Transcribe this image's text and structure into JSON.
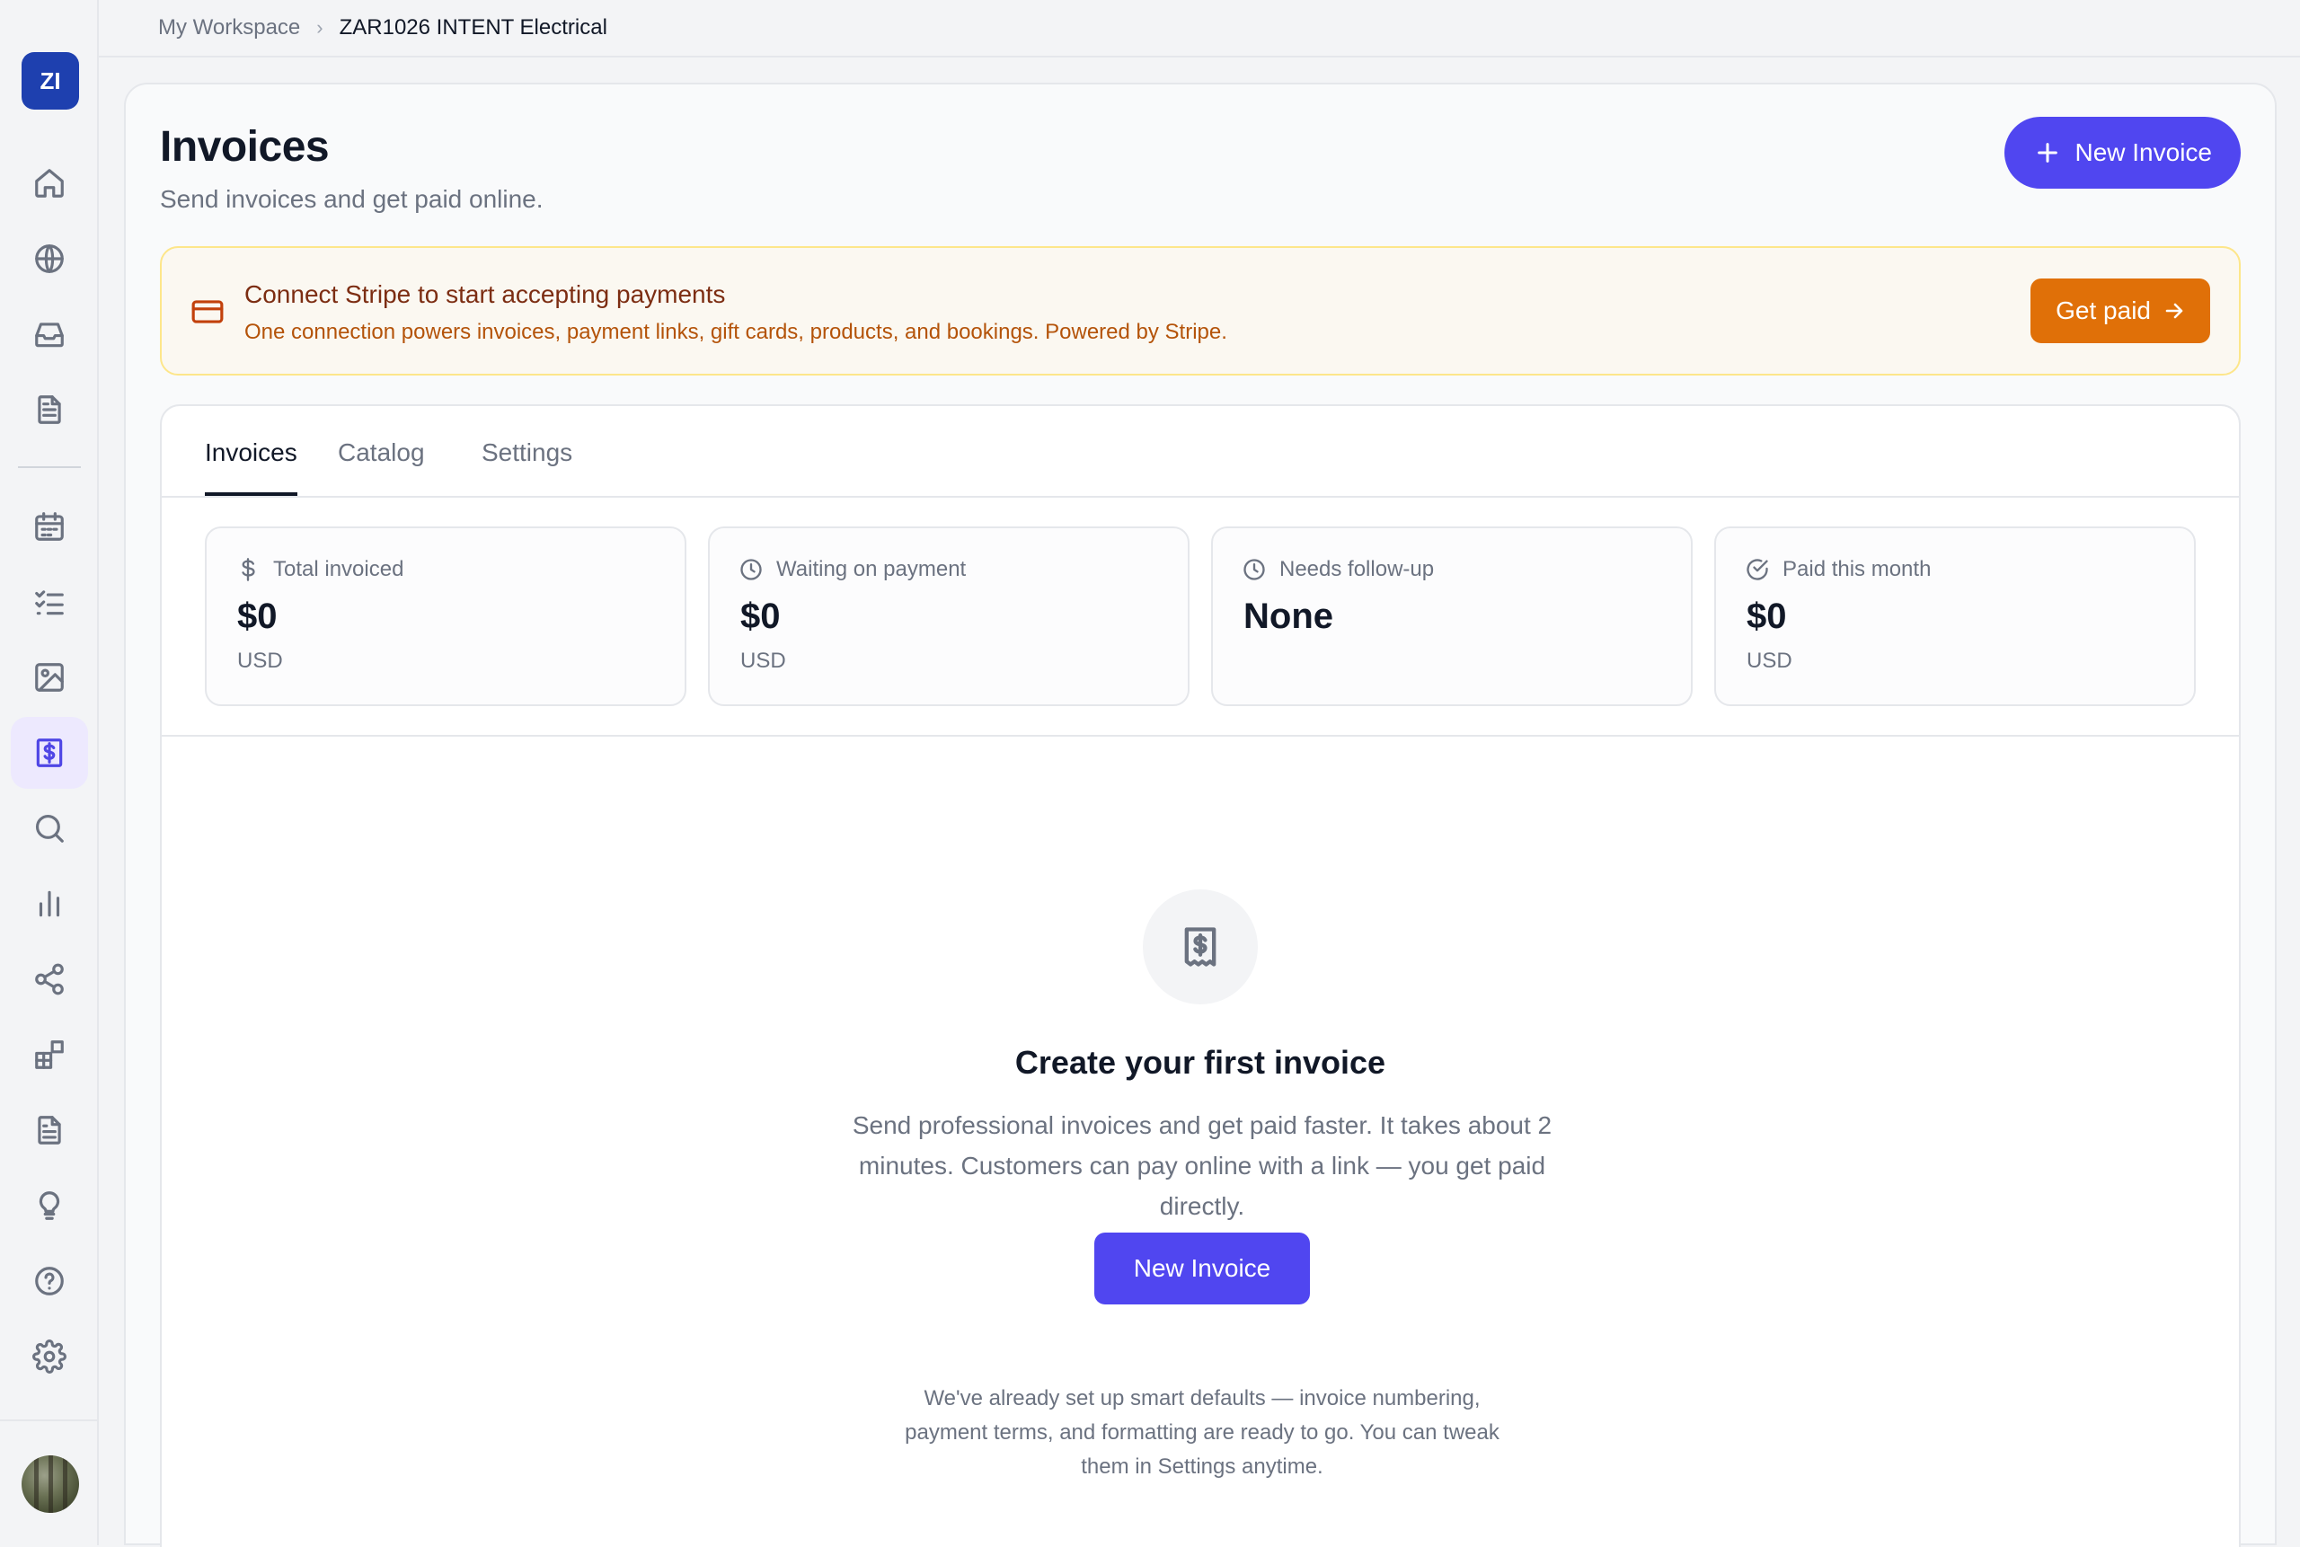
{
  "workspace": {
    "initials": "ZI"
  },
  "breadcrumb": {
    "root": "My Workspace",
    "current": "ZAR1026 INTENT Electrical"
  },
  "sidebar": {
    "items": [
      {
        "icon": "home-icon"
      },
      {
        "icon": "globe-icon"
      },
      {
        "icon": "inbox-icon"
      },
      {
        "icon": "document-icon"
      },
      {
        "icon": "calendar-icon"
      },
      {
        "icon": "checklist-icon"
      },
      {
        "icon": "image-icon"
      },
      {
        "icon": "invoice-icon",
        "active": true
      },
      {
        "icon": "search-icon"
      },
      {
        "icon": "bar-chart-icon"
      },
      {
        "icon": "share-icon"
      },
      {
        "icon": "apps-icon"
      },
      {
        "icon": "file-text-icon"
      },
      {
        "icon": "lightbulb-icon"
      },
      {
        "icon": "help-icon"
      },
      {
        "icon": "settings-icon"
      }
    ]
  },
  "header": {
    "title": "Invoices",
    "subtitle": "Send invoices and get paid online.",
    "new_invoice_label": "New Invoice"
  },
  "stripe": {
    "title": "Connect Stripe to start accepting payments",
    "description": "One connection powers invoices, payment links, gift cards, products, and bookings. Powered by Stripe.",
    "button_label": "Get paid"
  },
  "tabs": [
    {
      "label": "Invoices",
      "active": true
    },
    {
      "label": "Catalog"
    },
    {
      "label": "Settings"
    }
  ],
  "stats": [
    {
      "label": "Total invoiced",
      "value": "$0",
      "unit": "USD",
      "icon": "dollar-icon"
    },
    {
      "label": "Waiting on payment",
      "value": "$0",
      "unit": "USD",
      "icon": "clock-icon"
    },
    {
      "label": "Needs follow-up",
      "value": "None",
      "unit": "",
      "icon": "clock-icon"
    },
    {
      "label": "Paid this month",
      "value": "$0",
      "unit": "USD",
      "icon": "check-circle-icon"
    }
  ],
  "empty_state": {
    "title": "Create your first invoice",
    "description": "Send professional invoices and get paid faster. It takes about 2 minutes. Customers can pay online with a link — you get paid directly.",
    "button_label": "New Invoice",
    "note": "We've already set up smart defaults — invoice numbering, payment terms, and formatting are ready to go. You can tweak them in Settings anytime."
  },
  "colors": {
    "accent": "#5046f0",
    "stripe_button": "#e07008",
    "workspace_badge": "#1e40af"
  }
}
